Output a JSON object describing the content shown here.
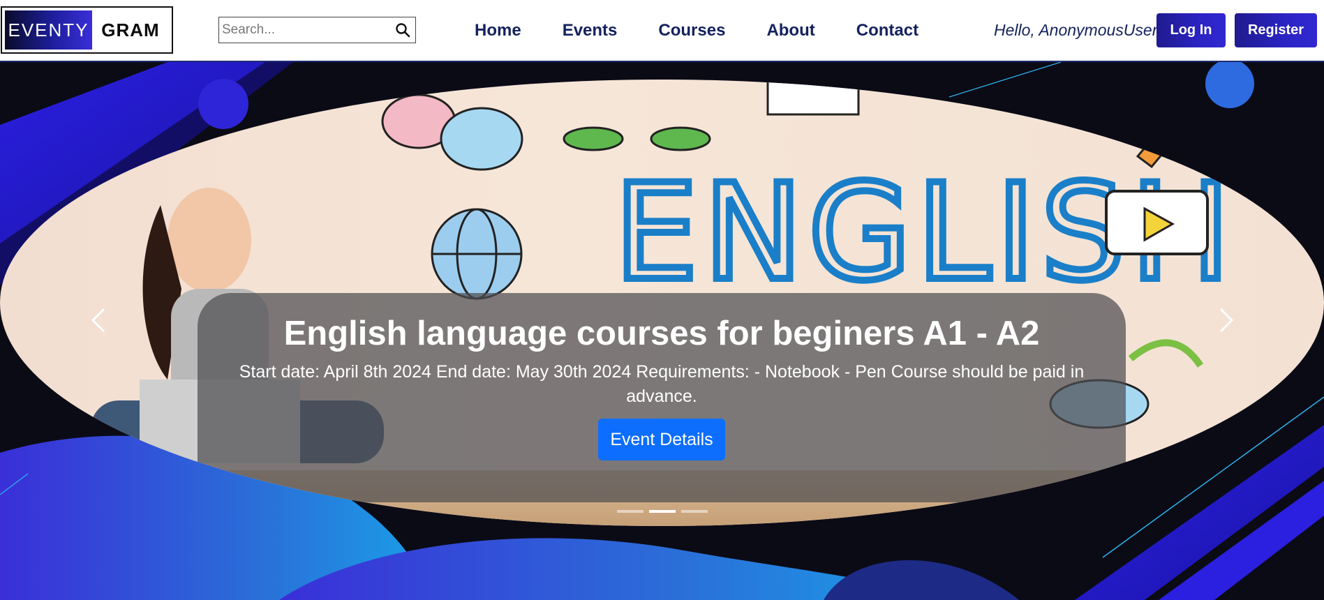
{
  "brand": {
    "logo_left": "EVENTY",
    "logo_right": "GRAM"
  },
  "search": {
    "placeholder": "Search...",
    "icon": "search-icon"
  },
  "nav": {
    "items": [
      {
        "label": "Home"
      },
      {
        "label": "Events"
      },
      {
        "label": "Courses"
      },
      {
        "label": "About"
      },
      {
        "label": "Contact"
      }
    ]
  },
  "user": {
    "greeting": "Hello, AnonymousUser",
    "login_label": "Log In",
    "register_label": "Register"
  },
  "carousel": {
    "slide": {
      "title": "English language courses for beginers A1 - A2",
      "description": "Start date: April 8th 2024 End date: May 30th 2024 Requirements: - Notebook - Pen Course should be paid in advance.",
      "button_label": "Event Details",
      "image_text": "ENGLISH"
    },
    "indicator_count": 3,
    "active_index": 1,
    "prev_icon": "chevron-left-icon",
    "next_icon": "chevron-right-icon"
  },
  "colors": {
    "nav_text": "#14225e",
    "button_gradient_start": "#1f1b8f",
    "button_gradient_end": "#3129d0",
    "primary": "#0d6efd",
    "hero_background": "#0a0a14"
  }
}
